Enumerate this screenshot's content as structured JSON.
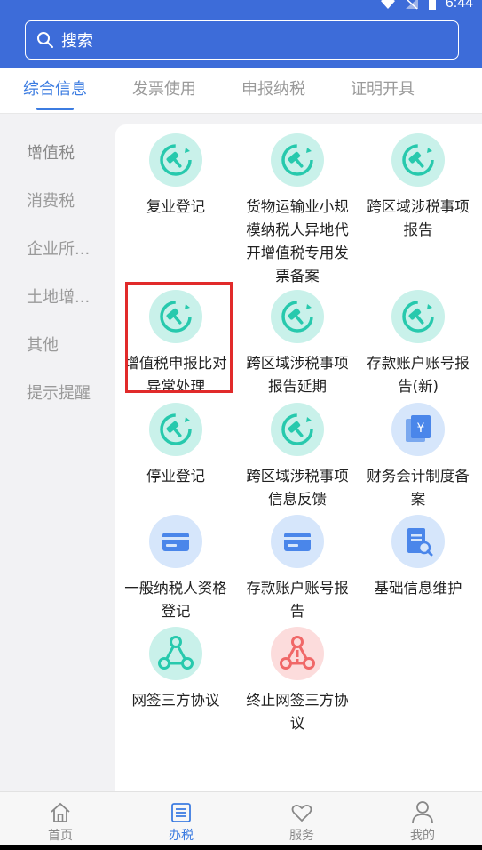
{
  "status": {
    "time": "6:44"
  },
  "search": {
    "placeholder": "搜索"
  },
  "tabs": [
    {
      "label": "综合信息",
      "active": true
    },
    {
      "label": "发票使用",
      "active": false
    },
    {
      "label": "申报纳税",
      "active": false
    },
    {
      "label": "证明开具",
      "active": false
    }
  ],
  "sidebar": [
    {
      "label": "增值税"
    },
    {
      "label": "消费税"
    },
    {
      "label": "企业所..."
    },
    {
      "label": "土地增..."
    },
    {
      "label": "其他"
    },
    {
      "label": "提示提醒"
    }
  ],
  "services": [
    {
      "label": "复业登记",
      "icon": "gavel-icon"
    },
    {
      "label": "货物运输业小规模纳税人异地代开增值税专用发票备案",
      "icon": "gavel-icon"
    },
    {
      "label": "跨区域涉税事项报告",
      "icon": "gavel-icon"
    },
    {
      "label": "增值税申报比对异常处理",
      "icon": "gavel-icon",
      "highlighted": true
    },
    {
      "label": "跨区域涉税事项报告延期",
      "icon": "gavel-icon"
    },
    {
      "label": "存款账户账号报告(新)",
      "icon": "gavel-icon"
    },
    {
      "label": "停业登记",
      "icon": "gavel-icon"
    },
    {
      "label": "跨区域涉税事项信息反馈",
      "icon": "gavel-icon"
    },
    {
      "label": "财务会计制度备案",
      "icon": "yuan-document-icon"
    },
    {
      "label": "一般纳税人资格登记",
      "icon": "card-icon"
    },
    {
      "label": "存款账户账号报告",
      "icon": "card-icon"
    },
    {
      "label": "基础信息维护",
      "icon": "document-search-icon"
    },
    {
      "label": "网签三方协议",
      "icon": "network-icon"
    },
    {
      "label": "终止网签三方协议",
      "icon": "network-alert-icon"
    }
  ],
  "bottom_nav": [
    {
      "label": "首页",
      "icon": "home-icon",
      "active": false
    },
    {
      "label": "办税",
      "icon": "list-icon",
      "active": true
    },
    {
      "label": "服务",
      "icon": "heart-icon",
      "active": false
    },
    {
      "label": "我的",
      "icon": "person-icon",
      "active": false
    }
  ],
  "colors": {
    "header": "#3d6cd9",
    "accent": "#3c7ce1",
    "highlight": "#e12a2a",
    "teal": "#27c9ad",
    "blue": "#4a86ea",
    "red": "#f06868"
  }
}
